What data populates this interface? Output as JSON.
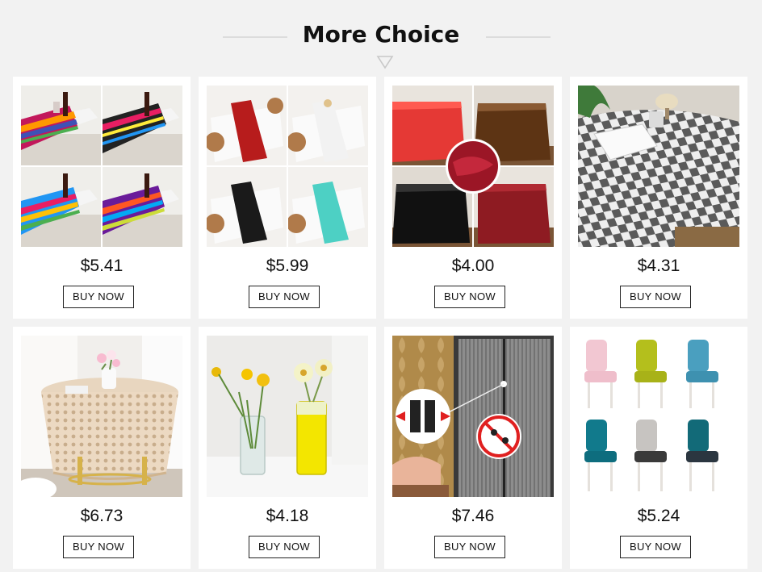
{
  "section": {
    "title": "More Choice"
  },
  "products": [
    {
      "price": "$5.41",
      "button": "BUY NOW",
      "image": "striped table runners"
    },
    {
      "price": "$5.99",
      "button": "BUY NOW",
      "image": "satin table runners"
    },
    {
      "price": "$4.00",
      "button": "BUY NOW",
      "image": "satin tablecloths"
    },
    {
      "price": "$4.31",
      "button": "BUY NOW",
      "image": "checkered tablecloth"
    },
    {
      "price": "$6.73",
      "button": "BUY NOW",
      "image": "crochet lace tablecloth"
    },
    {
      "price": "$4.18",
      "button": "BUY NOW",
      "image": "glass flower vases"
    },
    {
      "price": "$7.46",
      "button": "BUY NOW",
      "image": "magnetic mesh door screen"
    },
    {
      "price": "$5.24",
      "button": "BUY NOW",
      "image": "chair covers"
    }
  ]
}
